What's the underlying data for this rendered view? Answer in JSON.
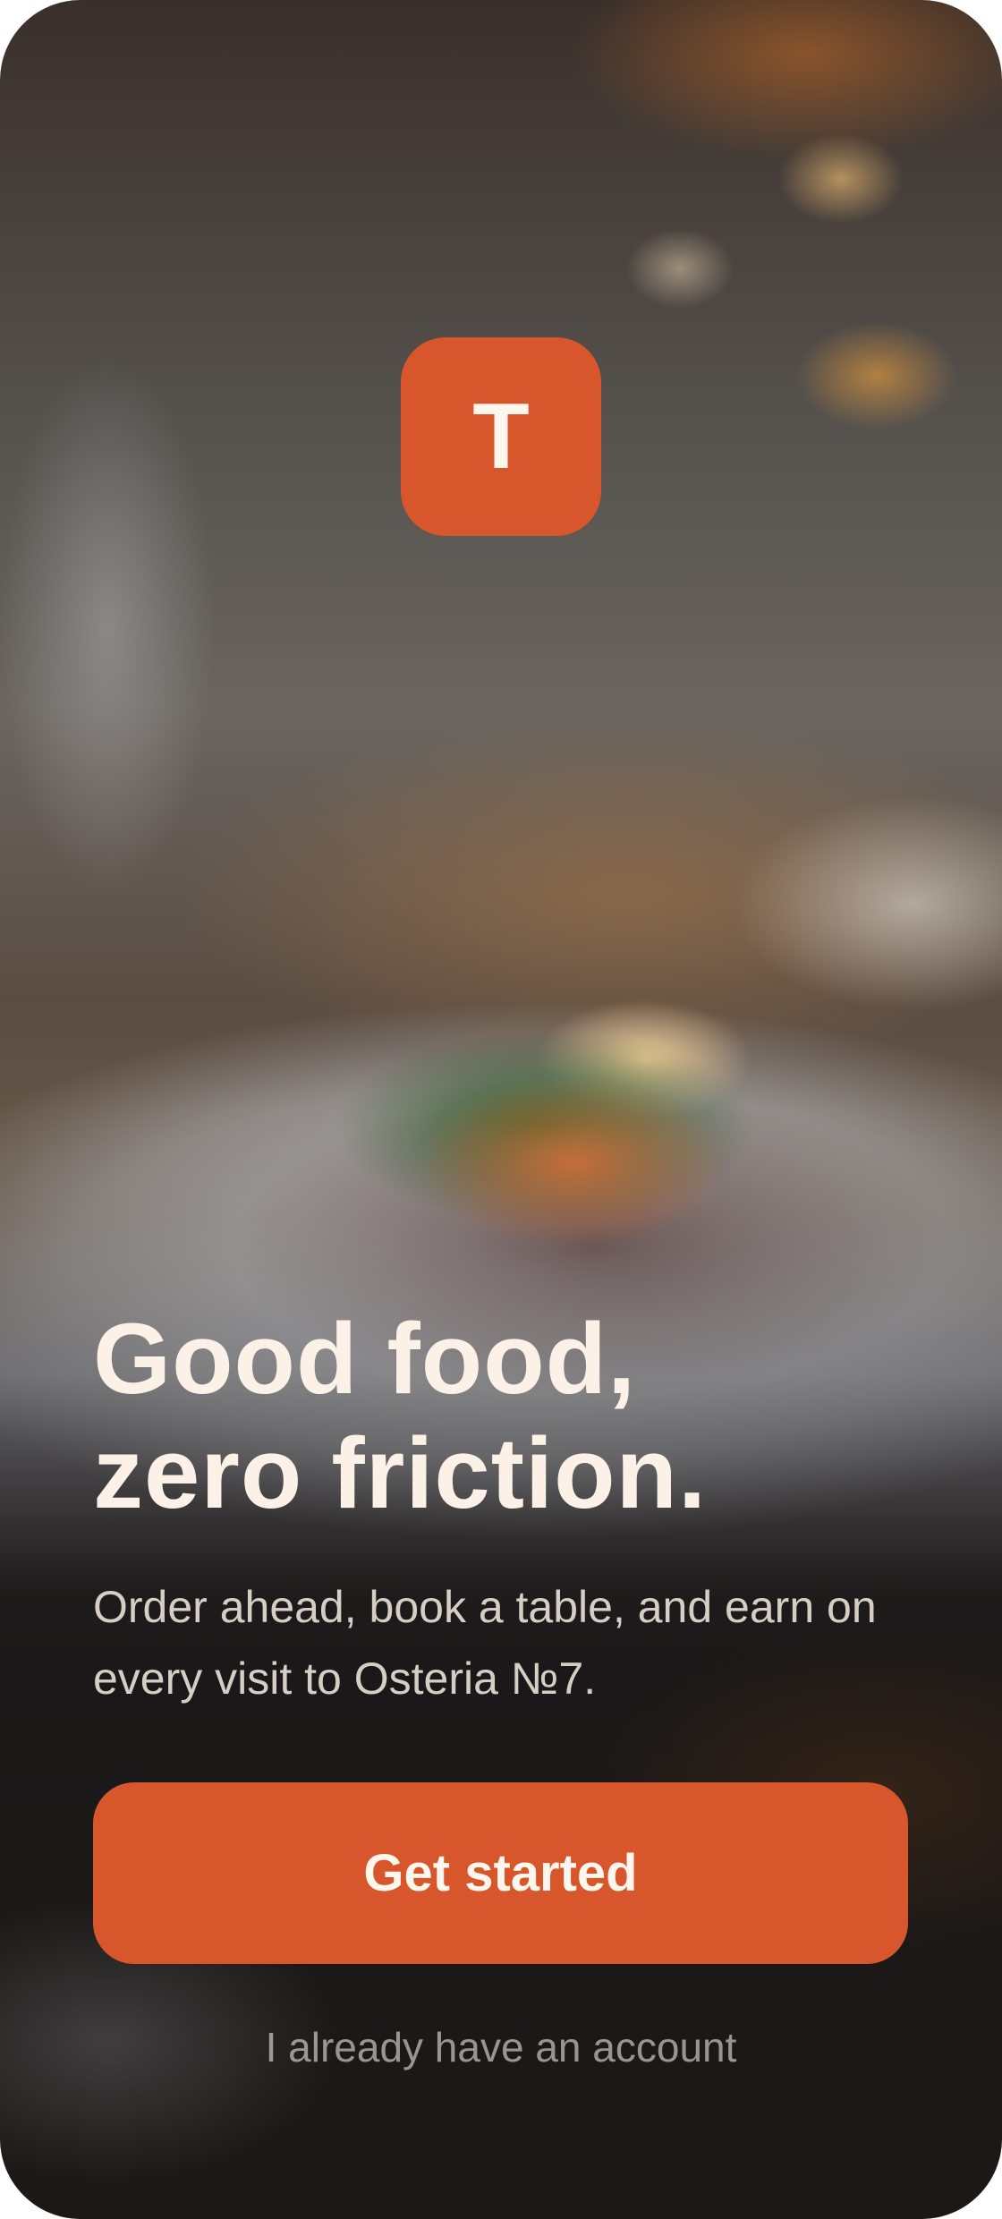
{
  "brand": {
    "logo_letter": "T",
    "accent_color": "#d8562c"
  },
  "hero": {
    "background": "blurred restaurant plate photo",
    "headline_line1": "Good food,",
    "headline_line2": "zero friction.",
    "subtitle": "Order ahead, book a table, and earn on every visit to Osteria №7."
  },
  "actions": {
    "primary_label": "Get started",
    "secondary_label": "I already have an account"
  }
}
